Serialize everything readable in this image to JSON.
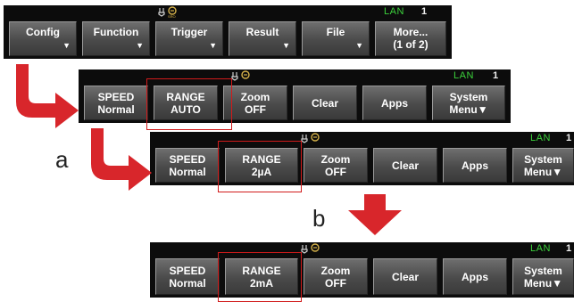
{
  "status": {
    "lan": "LAN",
    "lan_number": "1",
    "icon": "usb-plug-icon"
  },
  "menu1": {
    "buttons": [
      {
        "label": "Config",
        "arrow": "▼"
      },
      {
        "label": "Function",
        "arrow": "▼"
      },
      {
        "label": "Trigger",
        "arrow": "▼"
      },
      {
        "label": "Result",
        "arrow": "▼"
      },
      {
        "label": "File",
        "arrow": "▼"
      },
      {
        "label": "More...",
        "sub": "(1 of 2)"
      }
    ]
  },
  "menu2": {
    "buttons": [
      {
        "line1": "SPEED",
        "line2": "Normal"
      },
      {
        "line1": "RANGE",
        "line2": "AUTO"
      },
      {
        "line1": "Zoom",
        "line2": "OFF"
      },
      {
        "line1": "Clear",
        "line2": ""
      },
      {
        "line1": "Apps",
        "line2": ""
      },
      {
        "line1": "System",
        "line2": "Menu▼"
      }
    ]
  },
  "menu3": {
    "buttons": [
      {
        "line1": "SPEED",
        "line2": "Normal"
      },
      {
        "line1": "RANGE",
        "line2": "2µA"
      },
      {
        "line1": "Zoom",
        "line2": "OFF"
      },
      {
        "line1": "Clear",
        "line2": ""
      },
      {
        "line1": "Apps",
        "line2": ""
      },
      {
        "line1": "System",
        "line2": "Menu▼"
      }
    ]
  },
  "menu4": {
    "buttons": [
      {
        "line1": "SPEED",
        "line2": "Normal"
      },
      {
        "line1": "RANGE",
        "line2": "2mA"
      },
      {
        "line1": "Zoom",
        "line2": "OFF"
      },
      {
        "line1": "Clear",
        "line2": ""
      },
      {
        "line1": "Apps",
        "line2": ""
      },
      {
        "line1": "System",
        "line2": "Menu▼"
      }
    ]
  },
  "annotations": {
    "step_a": "a",
    "step_b": "b"
  },
  "colors": {
    "highlight": "#d11b1b",
    "arrow": "#d8262b",
    "lan_text": "#3cd23c"
  }
}
